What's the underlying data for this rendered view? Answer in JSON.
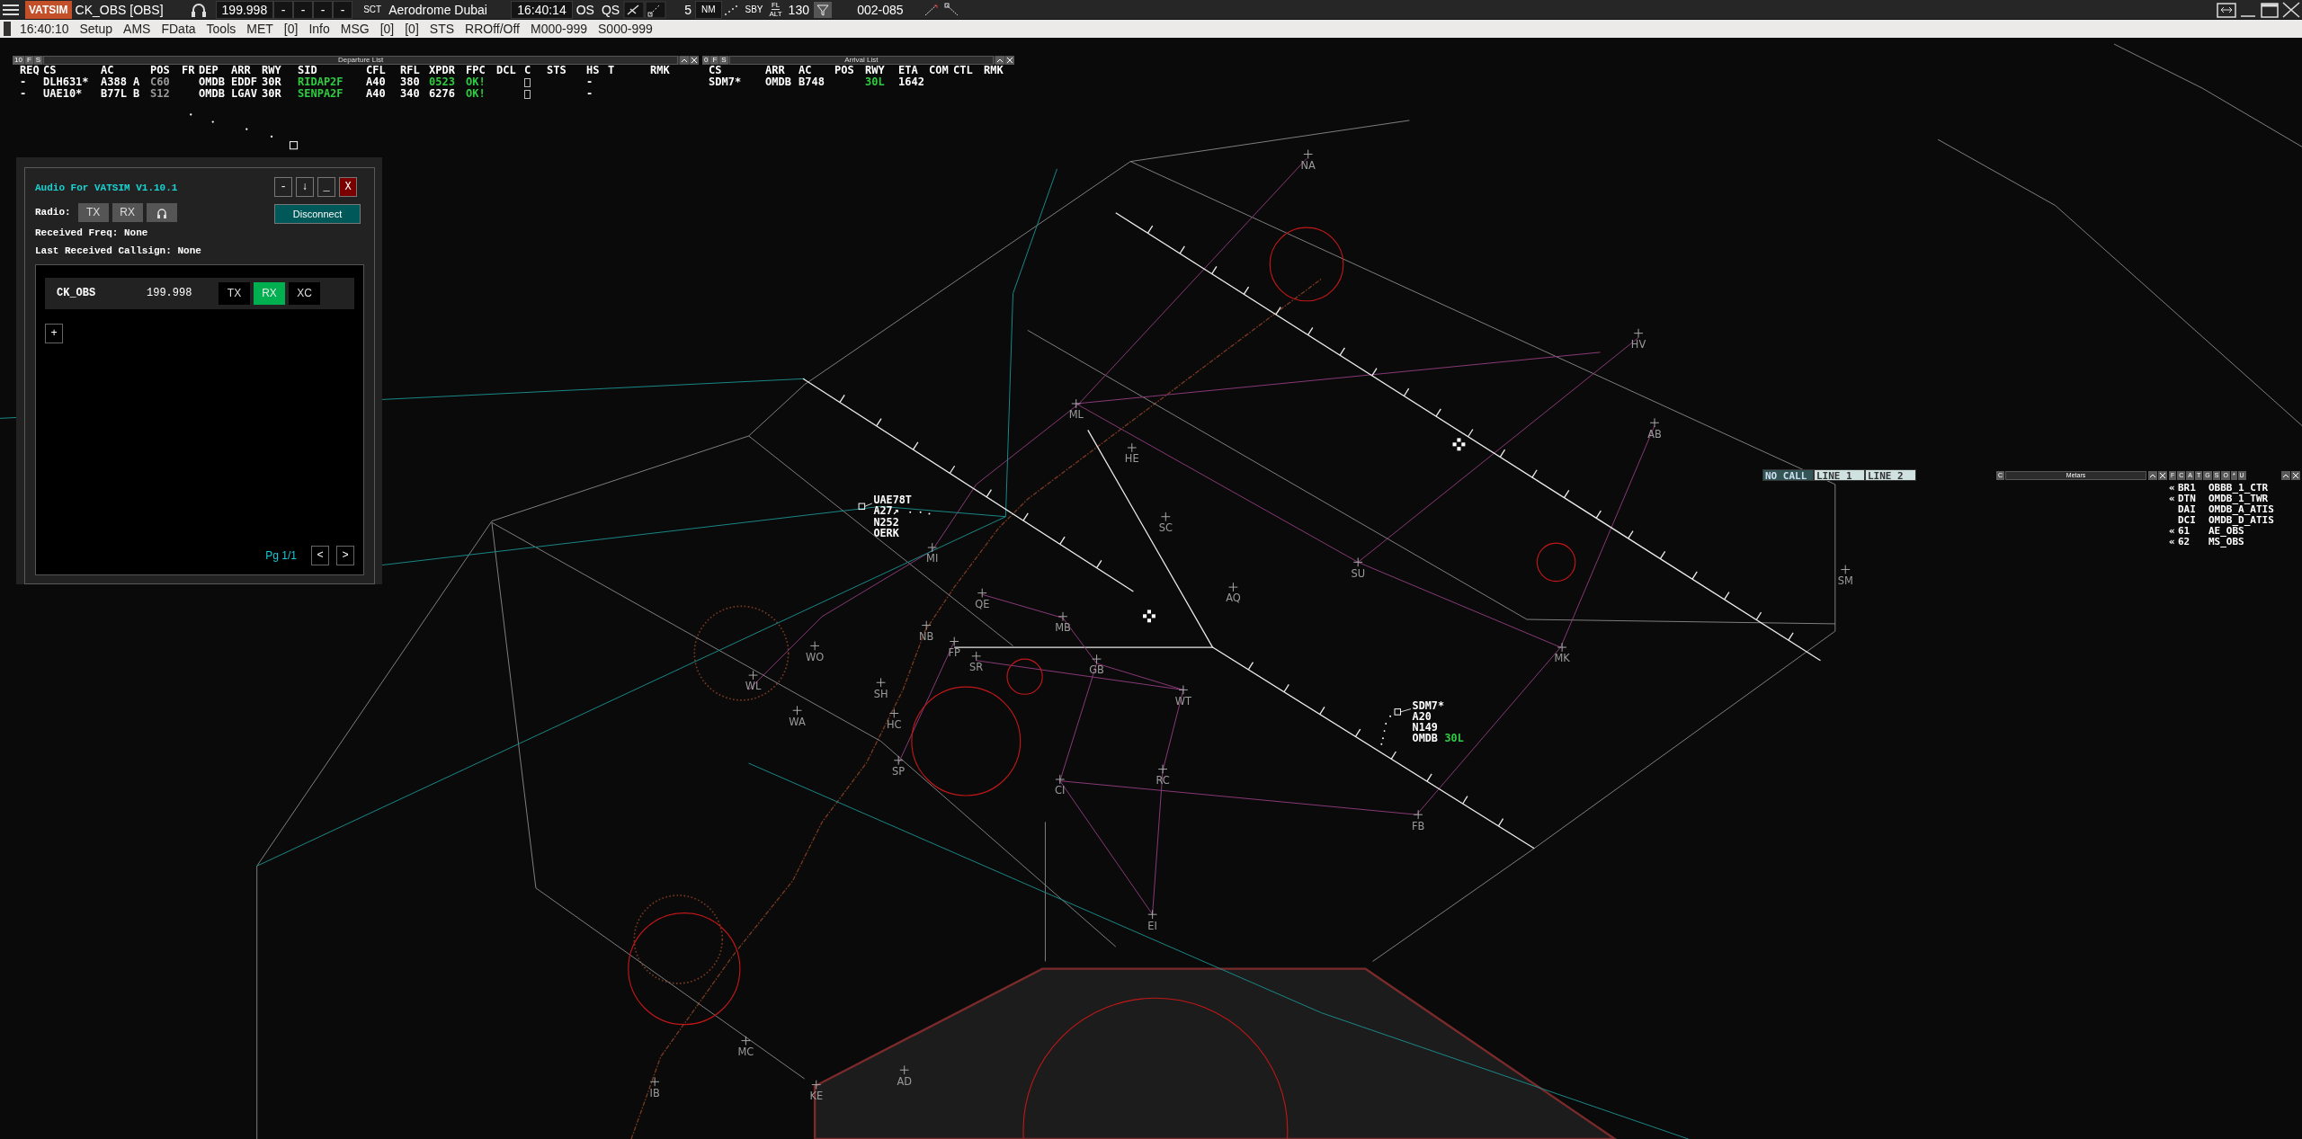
{
  "top_bar": {
    "app_logo": "VATSIM",
    "callsign": "CK_OBS [OBS]",
    "frequency": "199.998",
    "slots": [
      "-",
      "-",
      "-",
      "-"
    ],
    "sector_prefix": "SCT",
    "sector": "Aerodrome Dubai",
    "clock": "16:40:14",
    "modes": [
      "OS",
      "QS"
    ],
    "range": "5",
    "range_unit": "NM",
    "standby": "SBY",
    "level_type": [
      "FL",
      "ALT"
    ],
    "transition": "130",
    "filter": "002-085"
  },
  "menu_bar": {
    "items": [
      "16:40:10",
      "Setup",
      "AMS",
      "FData",
      "Tools",
      "MET",
      "[0]",
      "Info",
      "MSG",
      "[0]",
      "[0]",
      "STS",
      "RROff/Off",
      "M000-999",
      "S000-999"
    ]
  },
  "departure_list": {
    "header_buttons": [
      "10",
      "F",
      "S"
    ],
    "title": "Departure List",
    "columns": [
      "REQ",
      "CS",
      "AC",
      "POS",
      "FR",
      "DEP",
      "ARR",
      "RWY",
      "SID",
      "CFL",
      "RFL",
      "XPDR",
      "FPC",
      "DCL",
      "C",
      "STS",
      "HS",
      "T",
      "RMK"
    ],
    "rows": [
      {
        "req": "-",
        "cs": "DLH631*",
        "ac": "A388 A",
        "pos": {
          "text": "C60",
          "color": "#9a9a9a"
        },
        "dep": "OMDB",
        "arr": "EDDF",
        "rwy": "30R",
        "sid": {
          "text": "RIDAP2F",
          "color": "#2ecc40"
        },
        "cfl": "A40",
        "rfl": "380",
        "xpdr": {
          "text": "0523",
          "color": "#2ecc40"
        },
        "fpc": {
          "text": "OK!",
          "color": "#2ecc40"
        },
        "c": {
          "checked": false
        },
        "hs": "-"
      },
      {
        "req": "-",
        "cs": "UAE10*",
        "ac": "B77L B",
        "pos": {
          "text": "S12",
          "color": "#9a9a9a"
        },
        "dep": "OMDB",
        "arr": "LGAV",
        "rwy": "30R",
        "sid": {
          "text": "SENPA2F",
          "color": "#2ecc40"
        },
        "cfl": "A40",
        "rfl": "340",
        "xpdr": "6276",
        "fpc": {
          "text": "OK!",
          "color": "#2ecc40"
        },
        "c": {
          "checked": false
        },
        "hs": "-"
      }
    ]
  },
  "arrival_list": {
    "header_buttons": [
      "0",
      "F",
      "S"
    ],
    "title": "Arrival List",
    "columns": [
      "CS",
      "ARR",
      "AC",
      "POS",
      "RWY",
      "ETA",
      "COM",
      "CTL",
      "RMK"
    ],
    "rows": [
      {
        "cs": "SDM7*",
        "arr": "OMDB",
        "ac": "B748",
        "rwy": {
          "text": "30L",
          "color": "#2ecc40"
        },
        "eta": "1642"
      }
    ]
  },
  "audio_window": {
    "title": "Audio For VATSIM V1.10.1",
    "window_buttons": [
      {
        "label": "-",
        "kind": "plain"
      },
      {
        "label": "↓",
        "kind": "plain"
      },
      {
        "label": "_",
        "kind": "plain"
      },
      {
        "label": "X",
        "kind": "close"
      }
    ],
    "radio_label": "Radio:",
    "radio_buttons": [
      {
        "kind": "text",
        "label": "TX",
        "selected": false
      },
      {
        "kind": "text",
        "label": "RX",
        "selected": false
      },
      {
        "kind": "headset"
      }
    ],
    "disconnect": "Disconnect",
    "received_freq": "Received Freq: None",
    "last_callsign": "Last Received Callsign: None",
    "stations": [
      {
        "callsign": "CK_OBS",
        "frequency": "199.998",
        "modes": [
          {
            "label": "TX",
            "selected": false
          },
          {
            "label": "RX",
            "selected": true
          },
          {
            "label": "XC",
            "selected": false
          }
        ]
      }
    ],
    "add_button": "+",
    "page": "Pg 1/1",
    "pager": [
      "<",
      ">"
    ]
  },
  "voice_lines": [
    {
      "label": "NO CALL",
      "kind": "status"
    },
    {
      "label": "LINE 1",
      "kind": "line"
    },
    {
      "label": "LINE 2",
      "kind": "line"
    }
  ],
  "metars": {
    "buttons": [
      "C"
    ],
    "title": "Metars"
  },
  "controller_list": {
    "filters": [
      "F",
      "C",
      "A",
      "T",
      "G",
      "S",
      "O",
      "*",
      "U"
    ],
    "rows": [
      {
        "marker": "«",
        "id": "BR1",
        "callsign": "OBBB_1_CTR"
      },
      {
        "marker": "«",
        "id": "DTN",
        "callsign": "OMDB_1_TWR"
      },
      {
        "id": "DAI",
        "callsign": "OMDB_A_ATIS"
      },
      {
        "id": "DCI",
        "callsign": "OMDB_D_ATIS"
      },
      {
        "marker": "«",
        "id": "61",
        "callsign": "AE_OBS"
      },
      {
        "marker": "«",
        "id": "62",
        "callsign": "MS_OBS"
      }
    ]
  },
  "aircraft": [
    {
      "callsign": "UAE78T",
      "lines": [
        "A27↗",
        "N252",
        "OERK"
      ]
    },
    {
      "callsign": "SDM7*",
      "lines": [
        "A20",
        "N149"
      ],
      "destination": "OMDB",
      "runway": "30L"
    }
  ],
  "waypoints": [
    "NA",
    "HV",
    "ML",
    "AB",
    "HE",
    "SC",
    "MI",
    "SU",
    "SM",
    "AQ",
    "QE",
    "MB",
    "NB",
    "WO",
    "FP",
    "MK",
    "SR",
    "GB",
    "WL",
    "SH",
    "WT",
    "WA",
    "HC",
    "SP",
    "RC",
    "CI",
    "FB",
    "EI",
    "MC",
    "AD",
    "IB",
    "KE"
  ]
}
